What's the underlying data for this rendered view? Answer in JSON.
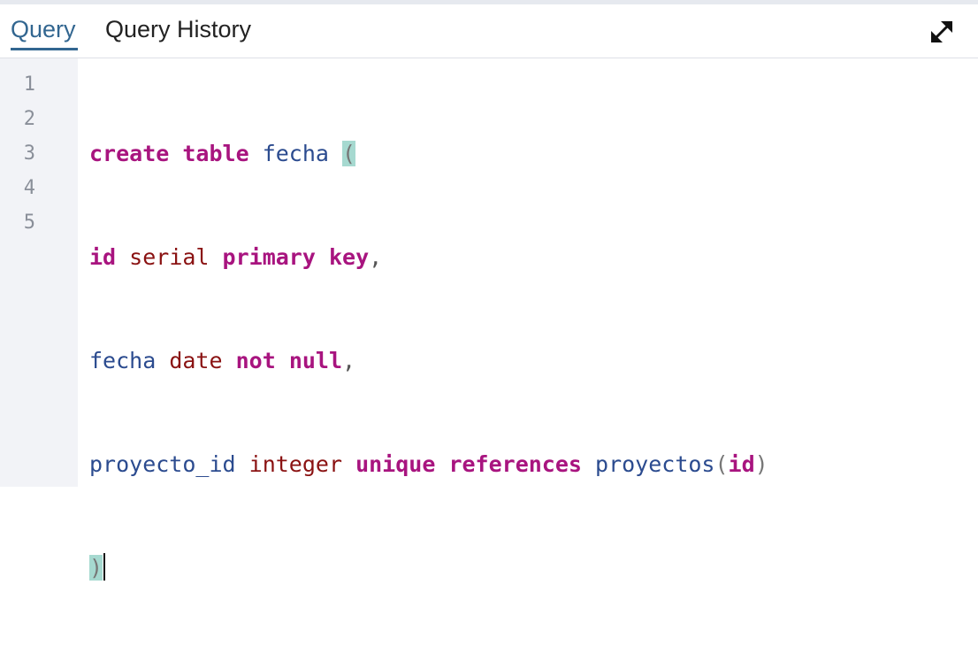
{
  "tabs": {
    "query": "Query",
    "history": "Query History"
  },
  "toolbar": {
    "expand_icon": "expand-icon"
  },
  "editor": {
    "line_numbers": [
      "1",
      "2",
      "3",
      "4",
      "5"
    ],
    "tokens": {
      "l1_create": "create",
      "l1_table": "table",
      "l1_name": "fecha",
      "l1_paren": "(",
      "l2_id": "id",
      "l2_serial": "serial",
      "l2_primary": "primary",
      "l2_key": "key",
      "l2_comma": ",",
      "l3_fecha": "fecha",
      "l3_date": "date",
      "l3_not": "not",
      "l3_null": "null",
      "l3_comma": ",",
      "l4_col": "proyecto_id",
      "l4_integer": "integer",
      "l4_unique": "unique",
      "l4_references": "references",
      "l4_table": "proyectos",
      "l4_open": "(",
      "l4_id": "id",
      "l4_close": ")",
      "l5_close": ")"
    }
  },
  "colors": {
    "active_tab": "#326690",
    "keyword": "#a8147f",
    "type": "#8a1212",
    "identifier": "#2b4b8f",
    "bracket_match": "#a6d9d0"
  }
}
